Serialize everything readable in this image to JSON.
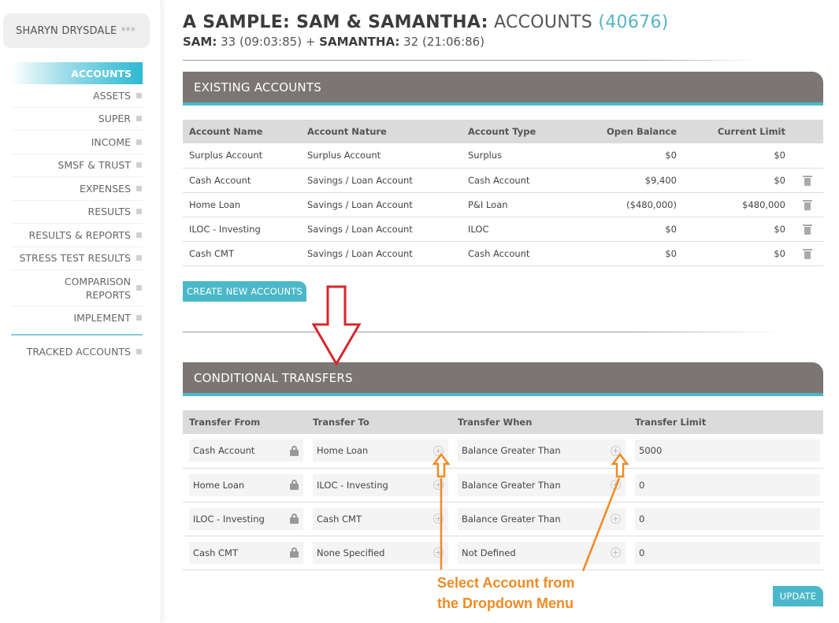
{
  "sidebar": {
    "user_name": "SHARYN DRYSDALE",
    "user_stars": "***",
    "items": [
      {
        "label": "ACCOUNTS"
      },
      {
        "label": "ASSETS"
      },
      {
        "label": "SUPER"
      },
      {
        "label": "INCOME"
      },
      {
        "label": "SMSF & TRUST"
      },
      {
        "label": "EXPENSES"
      },
      {
        "label": "RESULTS"
      },
      {
        "label": "RESULTS & REPORTS"
      },
      {
        "label": "STRESS TEST RESULTS"
      },
      {
        "label": "COMPARISON REPORTS"
      },
      {
        "label": "IMPLEMENT"
      }
    ],
    "tracked": "TRACKED ACCOUNTS"
  },
  "header": {
    "title_bold": "A SAMPLE: SAM & SAMANTHA:",
    "title_light": "ACCOUNTS",
    "count": "(40676)",
    "p1_name": "SAM:",
    "p1_detail": "33 (09:03:85) +",
    "p2_name": "SAMANTHA:",
    "p2_detail": "32 (21:06:86)"
  },
  "existing": {
    "title": "EXISTING ACCOUNTS",
    "columns": [
      "Account Name",
      "Account Nature",
      "Account Type",
      "Open Balance",
      "Current Limit"
    ],
    "rows": [
      [
        "Surplus Account",
        "Surplus Account",
        "Surplus",
        "$0",
        "$0"
      ],
      [
        "Cash Account",
        "Savings / Loan Account",
        "Cash Account",
        "$9,400",
        "$0"
      ],
      [
        "Home Loan",
        "Savings / Loan Account",
        "P&I Loan",
        "($480,000)",
        "$480,000"
      ],
      [
        "ILOC - Investing",
        "Savings / Loan Account",
        "ILOC",
        "$0",
        "$0"
      ],
      [
        "Cash CMT",
        "Savings / Loan Account",
        "Cash Account",
        "$0",
        "$0"
      ]
    ],
    "create_button": "CREATE NEW ACCOUNTS"
  },
  "transfers": {
    "title": "CONDITIONAL TRANSFERS",
    "columns": [
      "Transfer From",
      "Transfer To",
      "Transfer When",
      "Transfer Limit"
    ],
    "rows": [
      [
        "Cash Account",
        "Home Loan",
        "Balance Greater Than",
        "5000"
      ],
      [
        "Home Loan",
        "ILOC - Investing",
        "Balance Greater Than",
        "0"
      ],
      [
        "ILOC - Investing",
        "Cash CMT",
        "Balance Greater Than",
        "0"
      ],
      [
        "Cash CMT",
        "None Specified",
        "Not Defined",
        "0"
      ]
    ],
    "update_button": "UPDATE"
  },
  "annotation": {
    "line1": "Select Account from",
    "line2": "the Dropdown Menu",
    "color": "#f08a24"
  },
  "colors": {
    "accent": "#4bb8c9",
    "header_bg": "#7b7674",
    "arrow_red": "#d9262c"
  }
}
